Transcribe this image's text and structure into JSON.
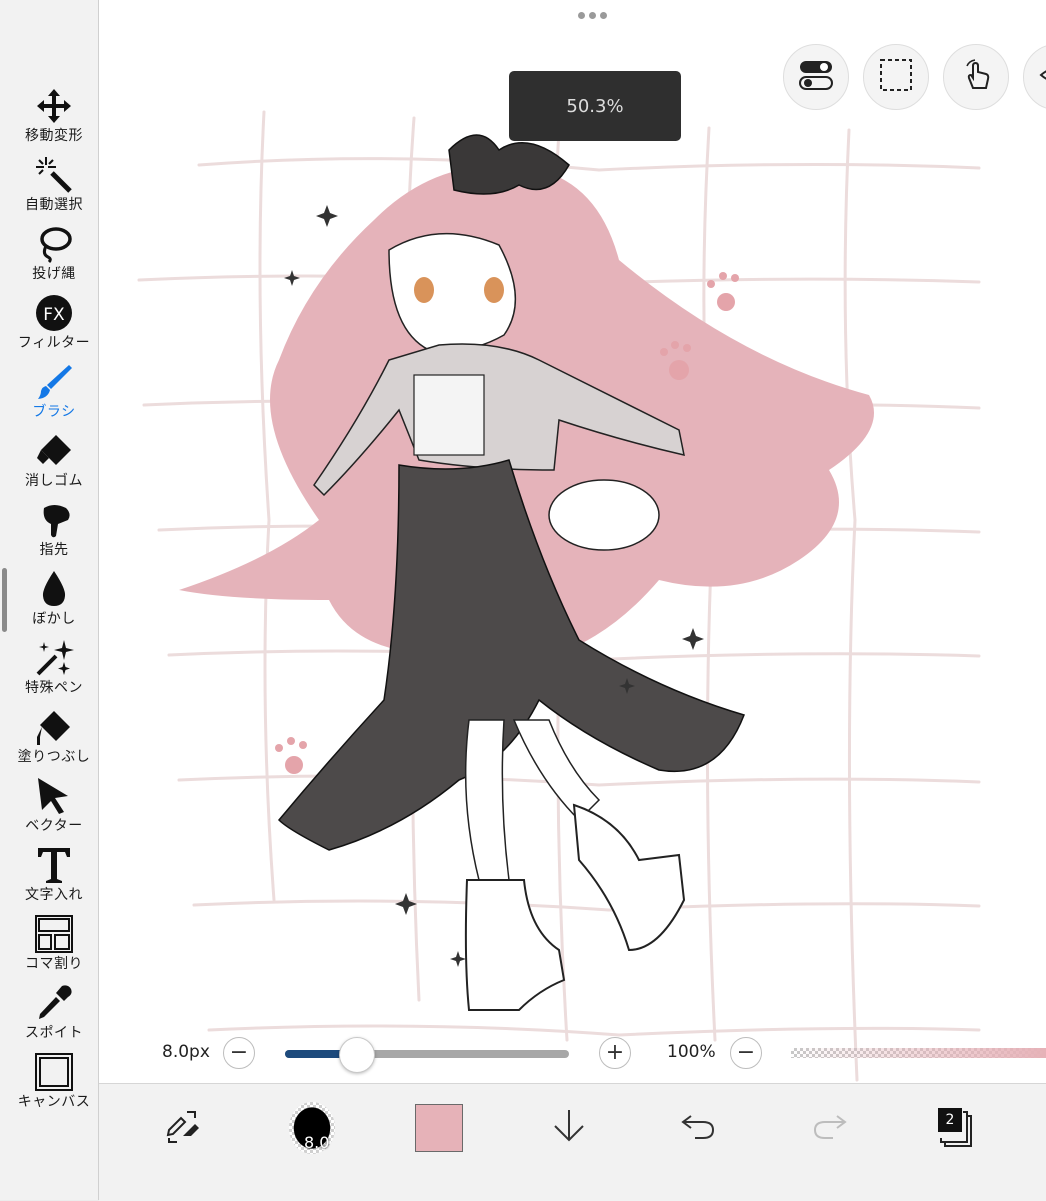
{
  "colors": {
    "accent": "#1478e6",
    "selected_color": "#e6b2b8",
    "slider_fill": "#1d4a7c",
    "zoom_popup_bg": "#2f2f2f"
  },
  "toolbar": {
    "tools": [
      {
        "label": "移動変形",
        "icon": "move-icon"
      },
      {
        "label": "自動選択",
        "icon": "magic-wand-icon"
      },
      {
        "label": "投げ縄",
        "icon": "lasso-icon"
      },
      {
        "label": "フィルター",
        "icon": "fx-icon"
      },
      {
        "label": "ブラシ",
        "icon": "brush-icon",
        "active": true
      },
      {
        "label": "消しゴム",
        "icon": "eraser-icon"
      },
      {
        "label": "指先",
        "icon": "finger-smudge-icon"
      },
      {
        "label": "ぼかし",
        "icon": "blur-drop-icon"
      },
      {
        "label": "特殊ペン",
        "icon": "sparkle-pen-icon"
      },
      {
        "label": "塗りつぶし",
        "icon": "bucket-fill-icon"
      },
      {
        "label": "ベクター",
        "icon": "vector-cursor-icon"
      },
      {
        "label": "文字入れ",
        "icon": "text-icon"
      },
      {
        "label": "コマ割り",
        "icon": "frame-divider-icon"
      },
      {
        "label": "スポイト",
        "icon": "eyedropper-icon"
      },
      {
        "label": "キャンバス",
        "icon": "canvas-icon"
      }
    ],
    "fx_text": "FX"
  },
  "canvas": {
    "zoom_popup": "50.3%",
    "quick_buttons": [
      "toggle-icon",
      "selection-rect-icon",
      "touch-gesture-icon",
      "eye-icon"
    ]
  },
  "brush_slider": {
    "size_label": "8.0px",
    "minus": "−",
    "plus": "+",
    "size_fraction": 0.25,
    "opacity_label": "100%",
    "opacity_minus": "−"
  },
  "bottom_bar": {
    "brush_size_text": "8.0",
    "layer_count": "2",
    "items": [
      "swap-color-icon",
      "brush-preview",
      "color-swatch",
      "download-arrow-icon",
      "undo-icon",
      "redo-icon",
      "layers-icon"
    ]
  }
}
